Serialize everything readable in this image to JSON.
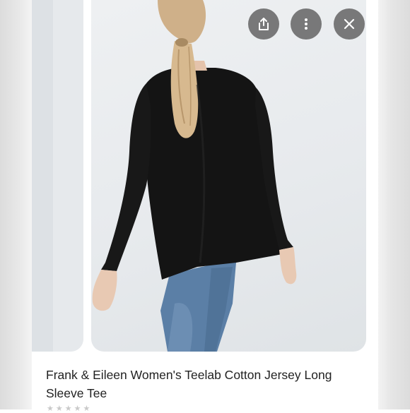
{
  "product": {
    "title": "Frank & Eileen Women's Teelab Cotton Jersey Long Sleeve Tee",
    "image_alt": "Woman with blonde ponytail wearing a black long sleeve tee and blue jeans, back view",
    "rating_stars": 5
  },
  "toolbar": {
    "share_icon": "share-icon",
    "more_icon": "more-vertical-icon",
    "close_icon": "close-icon"
  },
  "colors": {
    "icon_button_bg": "#6f6f6f",
    "title_text": "#222222",
    "shirt": "#141414",
    "jeans": "#5b7fa6"
  }
}
